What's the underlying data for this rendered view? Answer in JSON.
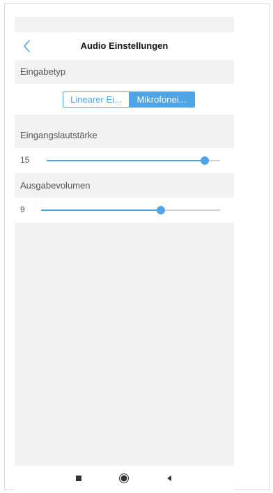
{
  "header": {
    "title": "Audio Einstellungen",
    "back_icon": "chevron-left-icon"
  },
  "input_type": {
    "label": "Eingabetyp",
    "options": [
      "Linearer Ei...",
      "Mikrofonei..."
    ],
    "selected_index": 1
  },
  "input_volume": {
    "label": "Eingangslautstärke",
    "value": "15",
    "fraction": 0.91
  },
  "output_volume": {
    "label": "Ausgabevolumen",
    "value": "9",
    "fraction": 0.67
  },
  "navbar": {
    "icons": [
      "square-icon",
      "circle-icon",
      "triangle-back-icon"
    ]
  },
  "colors": {
    "accent": "#4ea4e4",
    "background": "#f2f2f2",
    "track": "#cfcfcf"
  }
}
